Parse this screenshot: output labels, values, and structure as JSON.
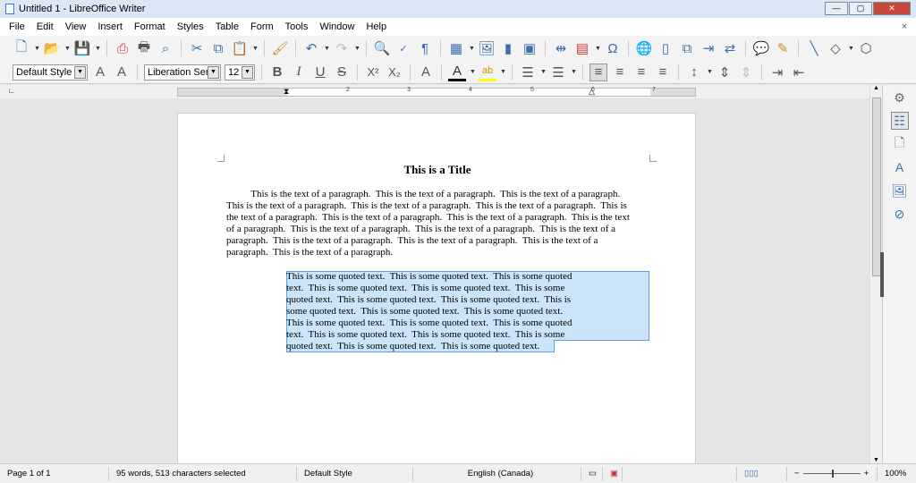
{
  "window": {
    "title": "Untitled 1 - LibreOffice Writer",
    "min": "—",
    "max": "▢",
    "close": "✕"
  },
  "menu": [
    "File",
    "Edit",
    "View",
    "Insert",
    "Format",
    "Styles",
    "Table",
    "Form",
    "Tools",
    "Window",
    "Help"
  ],
  "menu_close": "×",
  "format_bar": {
    "paragraph_style": "Default Style",
    "font_name": "Liberation Serif",
    "font_size": "12"
  },
  "ruler": {
    "numbers": [
      "1",
      "2",
      "3",
      "4",
      "5",
      "6",
      "7"
    ]
  },
  "document": {
    "title": "This is a Title",
    "paragraph_lines": [
      "          This is the text of a paragraph.  This is the text of a paragraph.  This is the text of a paragraph.",
      "This is the text of a paragraph.  This is the text of a paragraph.  This is the text of a paragraph.  This is",
      "the text of a paragraph.  This is the text of a paragraph.  This is the text of a paragraph.  This is the text",
      "of a paragraph.  This is the text of a paragraph.  This is the text of a paragraph.  This is the text of a",
      "paragraph.  This is the text of a paragraph.  This is the text of a paragraph.  This is the text of a",
      "paragraph.  This is the text of a paragraph."
    ],
    "quote_lines": [
      "This is some quoted text.  This is some quoted text.  This is some quoted",
      "text.  This is some quoted text.  This is some quoted text.  This is some",
      "quoted text.  This is some quoted text.  This is some quoted text.  This is",
      "some quoted text.  This is some quoted text.  This is some quoted text.",
      "This is some quoted text.  This is some quoted text.  This is some quoted",
      "text.  This is some quoted text.  This is some quoted text.  This is some",
      "quoted text.  This is some quoted text.  This is some quoted text."
    ]
  },
  "status": {
    "page": "Page 1 of 1",
    "words": "95 words, 513 characters selected",
    "style": "Default Style",
    "language": "English (Canada)",
    "zoom": "100%",
    "zoom_minus": "−",
    "zoom_plus": "+"
  },
  "colors": {
    "selection": "#cce4fa",
    "font_color": "#000000",
    "highlight": "#ffff00"
  }
}
